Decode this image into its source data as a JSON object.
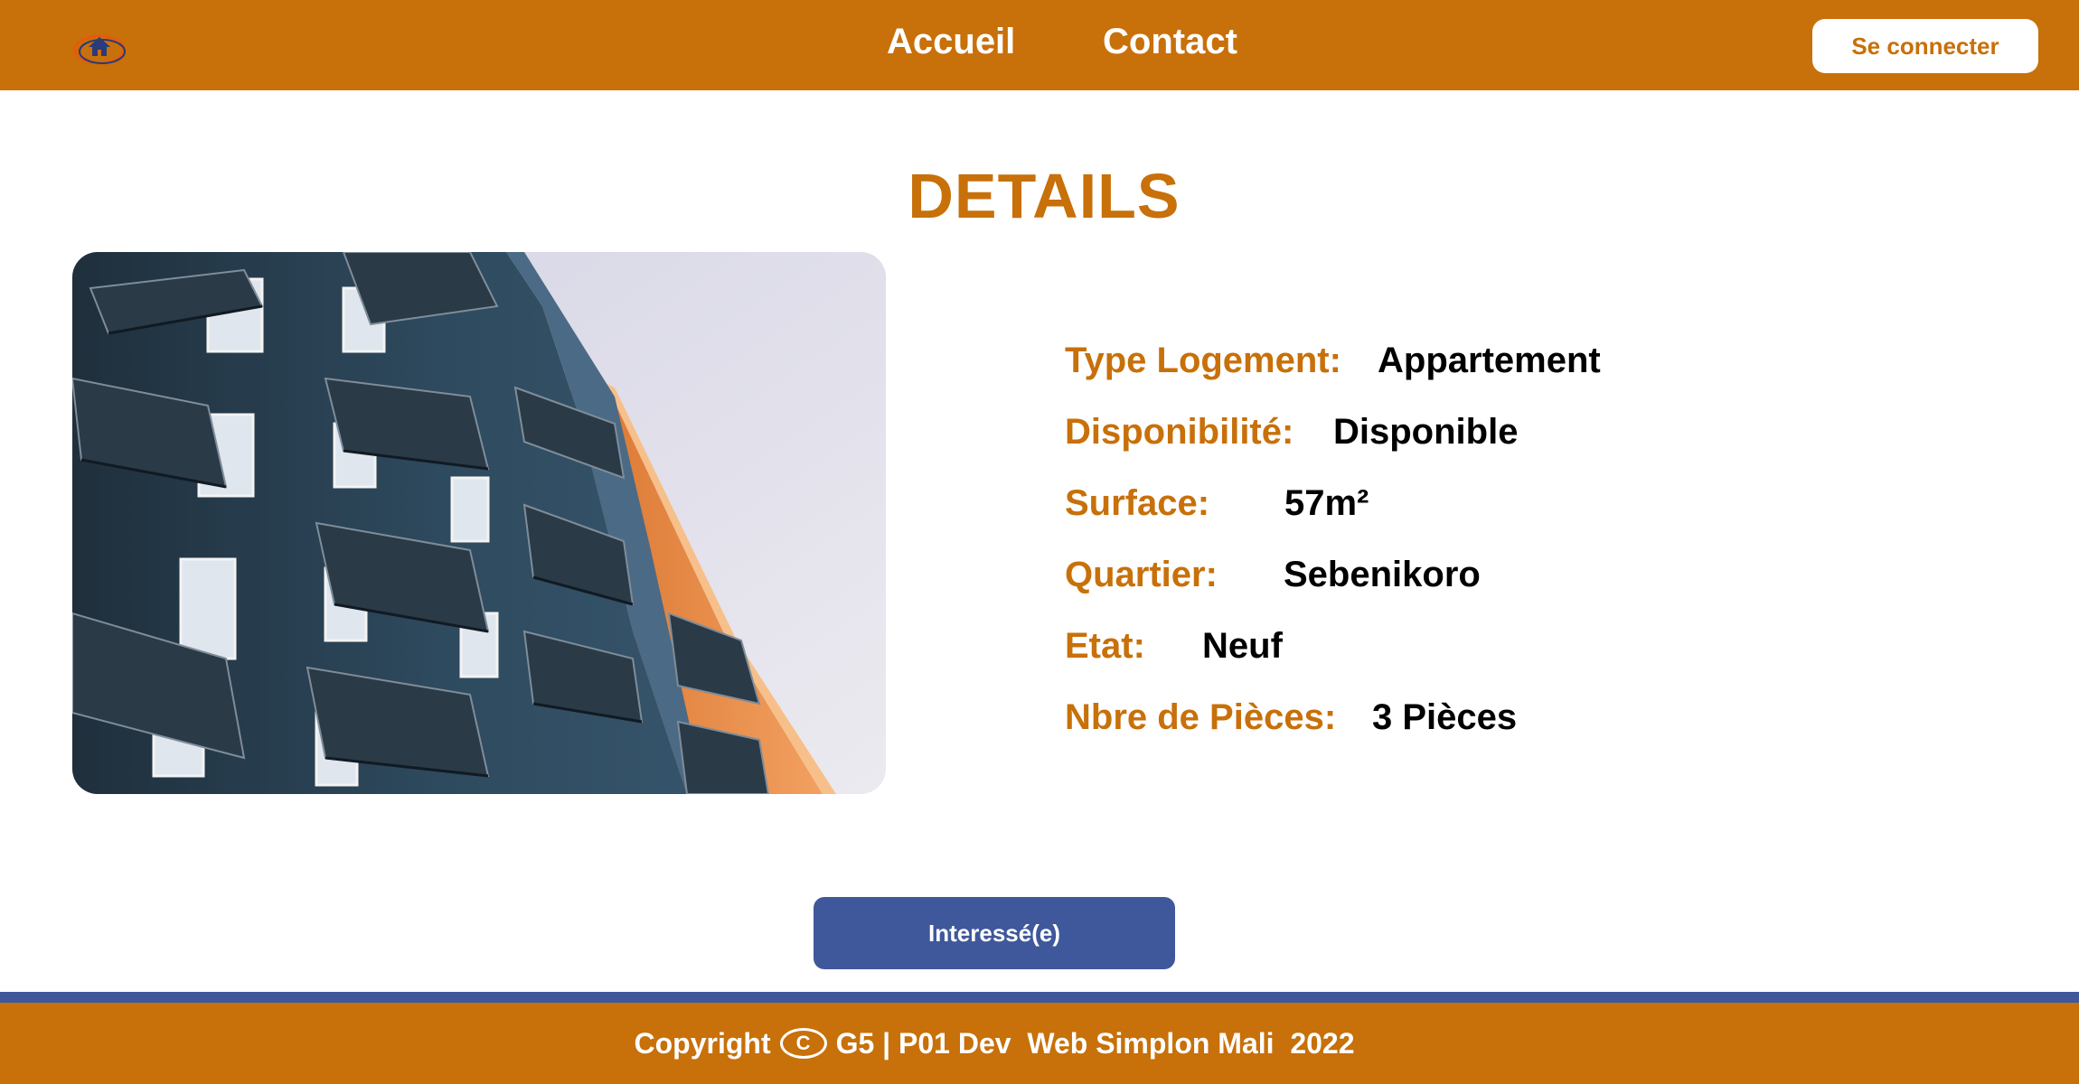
{
  "colors": {
    "brand_orange": "#c87009",
    "accent_blue": "#3f589c",
    "text_dark": "#000000",
    "white": "#ffffff"
  },
  "header": {
    "logo_icon": "house-logo-icon",
    "nav": [
      {
        "label": "Accueil"
      },
      {
        "label": "Contact"
      }
    ],
    "login_label": "Se connecter"
  },
  "page": {
    "title": "DETAILS"
  },
  "details": [
    {
      "label": "Type Logement:",
      "value": "Appartement"
    },
    {
      "label": "Disponibilité:",
      "value": "Disponible"
    },
    {
      "label": "Surface:",
      "value": "57m²"
    },
    {
      "label": "Quartier:",
      "value": "Sebenikoro"
    },
    {
      "label": "Etat:",
      "value": "Neuf"
    },
    {
      "label": "Nbre de Pièces:",
      "value": "3 Pièces"
    }
  ],
  "actions": {
    "interest_label": "Interessé(e)"
  },
  "footer": {
    "prefix": "Copyright",
    "icon": "copyright-icon",
    "text": "G5 | P01 Dev  Web Simplon Mali  2022"
  }
}
